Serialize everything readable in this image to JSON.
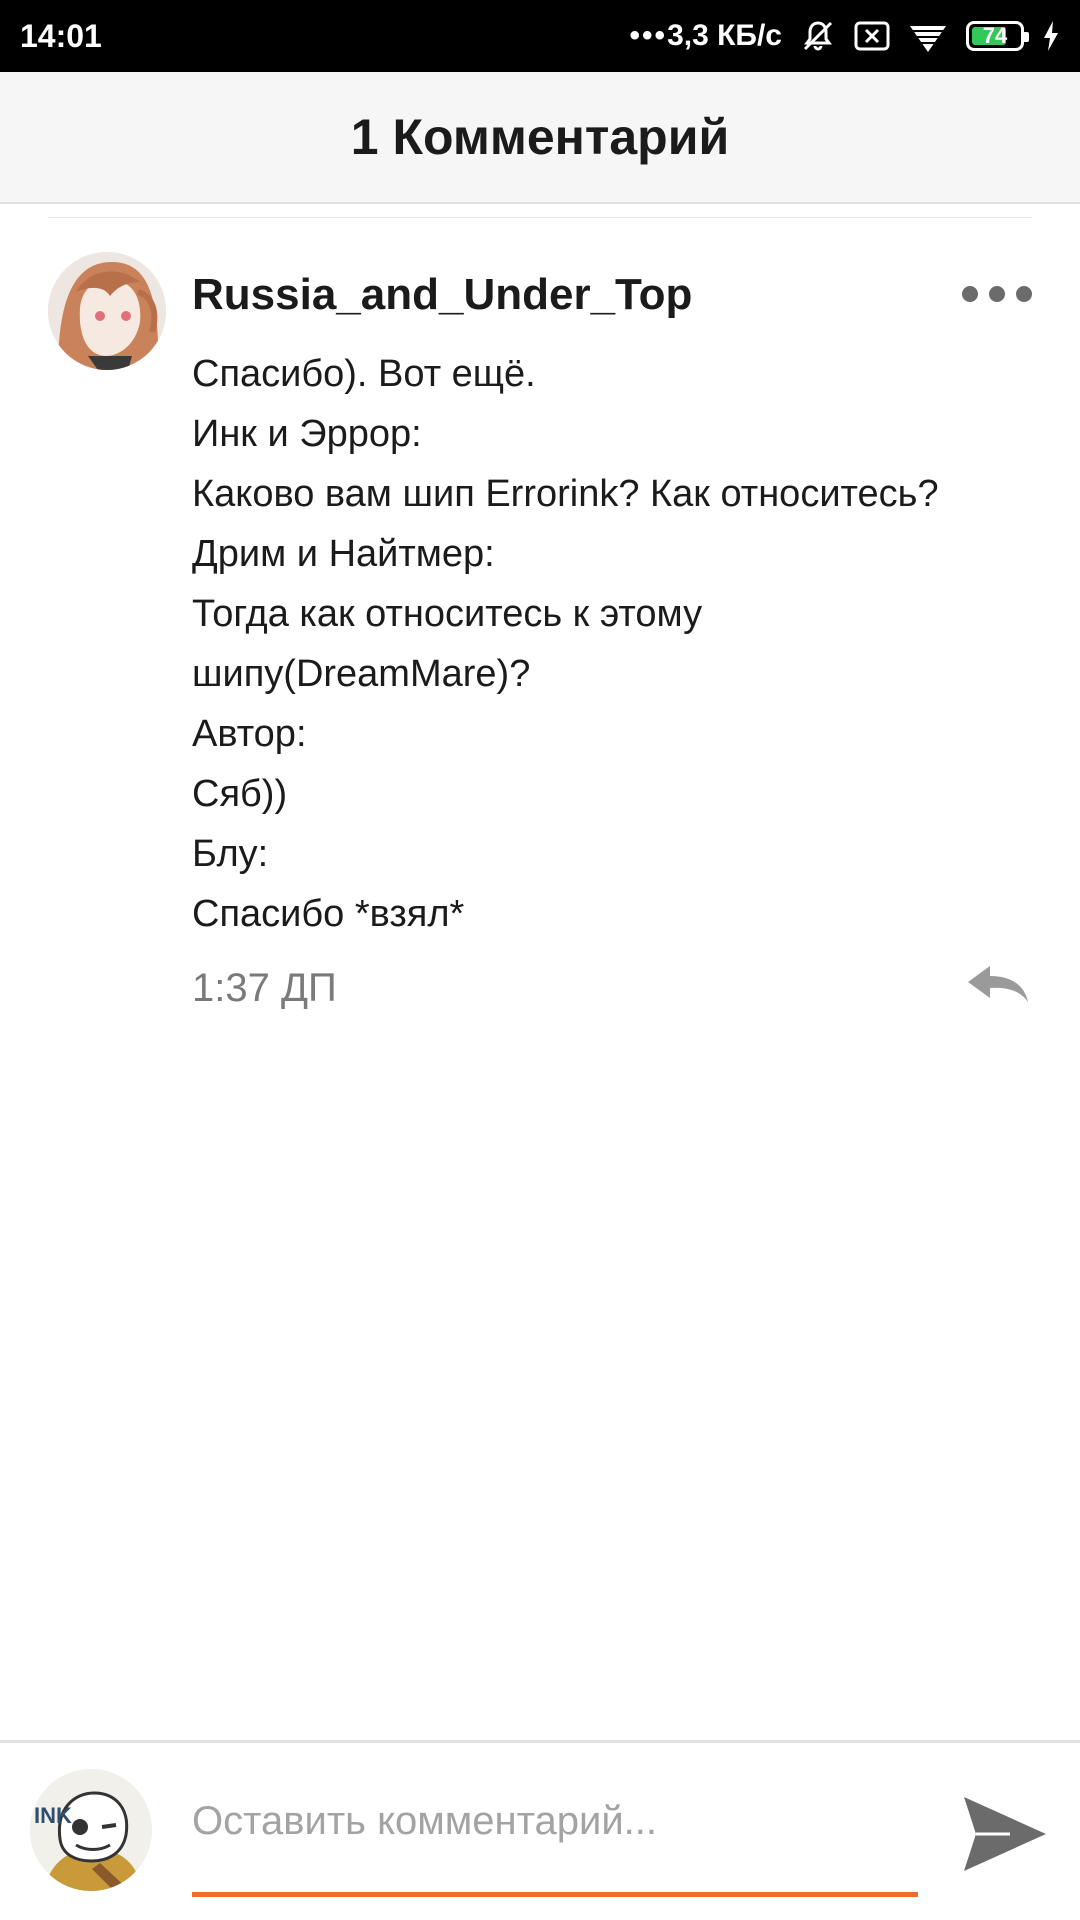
{
  "status_bar": {
    "time": "14:01",
    "dots": "•••",
    "network_speed": "3,3 КБ/с",
    "battery_level": "74",
    "battery_fraction": 0.74,
    "icons": [
      "mute-bell-icon",
      "sim-x-icon",
      "wifi-icon",
      "battery-icon",
      "charging-bolt-icon"
    ]
  },
  "header": {
    "title": "1 Комментарий"
  },
  "comment": {
    "author": "Russia_and_Under_Top",
    "lines": [
      "Спасибо). Вот ещё.",
      "Инк и Эррор:",
      "Каково вам шип Errorink? Как относитесь?",
      "Дрим и Найтмер:",
      "Тогда как относитесь к этому",
      "шипу(DreamMare)?",
      "Автор:",
      "Сяб))",
      "Блу:",
      "Спасибо *взял*"
    ],
    "time": "1:37 ДП",
    "more_icon": "more-horizontal-icon",
    "reply_icon": "reply-arrow-icon"
  },
  "composer": {
    "placeholder": "Оставить комментарий...",
    "value": "",
    "avatar_logo_text": "INK",
    "send_icon": "send-icon"
  },
  "colors": {
    "accent": "#f26b2b",
    "status_bar": "#000000",
    "header_bg": "#f6f6f6",
    "battery": "#34c759",
    "icon_gray": "#6b6b6b"
  }
}
